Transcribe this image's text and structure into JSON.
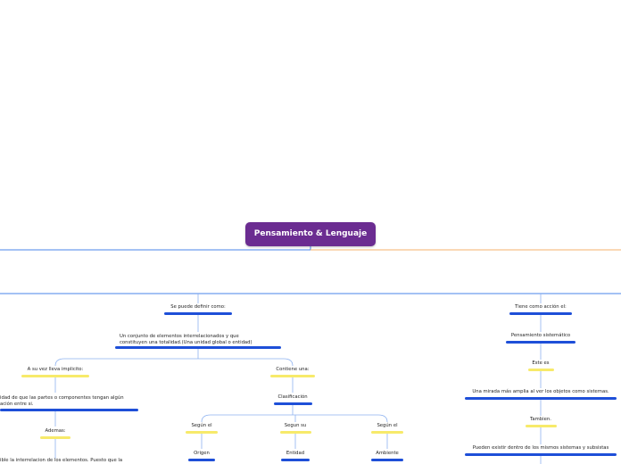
{
  "map": {
    "root": "Pensamiento & Lenguaje",
    "left": {
      "n1": "Se puede definir como:",
      "n2_line1": "Un conjunto de elementos interrelacionados y que",
      "n2_line2": "constituyen una totalidad.(Una unidad global o entidad)",
      "n3": "A su vez lleva implicito:",
      "n4_line1": "idad de que las partes o componentes tengan algún",
      "n4_line2": "ación entre si.",
      "n5": "Ademas:",
      "n6": "ible la interrelacion de los elementos. Puesto que la",
      "n7": "Contiene una:",
      "n8": "Clasificación",
      "n9": "Según el",
      "n10": "Origen",
      "n11": "Segun su",
      "n12": "Entidad",
      "n13": "Según el",
      "n14": "Ambiente"
    },
    "right": {
      "n1": "Tiene como acción el:",
      "n2": "Pensamiento sistemático",
      "n3": "Este es",
      "n4": "Una mirada más amplia al ver los objetos como sistemas.",
      "n5": "Tambien.",
      "n6": "Pueden existir dentro de los mismos sistemas y subsistas"
    }
  },
  "colors": {
    "root_bg": "#6b2c91",
    "line_blue": "#4a86e8",
    "line_orange": "#f6b26b",
    "underline_blue": "#1e4fd8",
    "underline_yellow": "#f7ea6a"
  }
}
